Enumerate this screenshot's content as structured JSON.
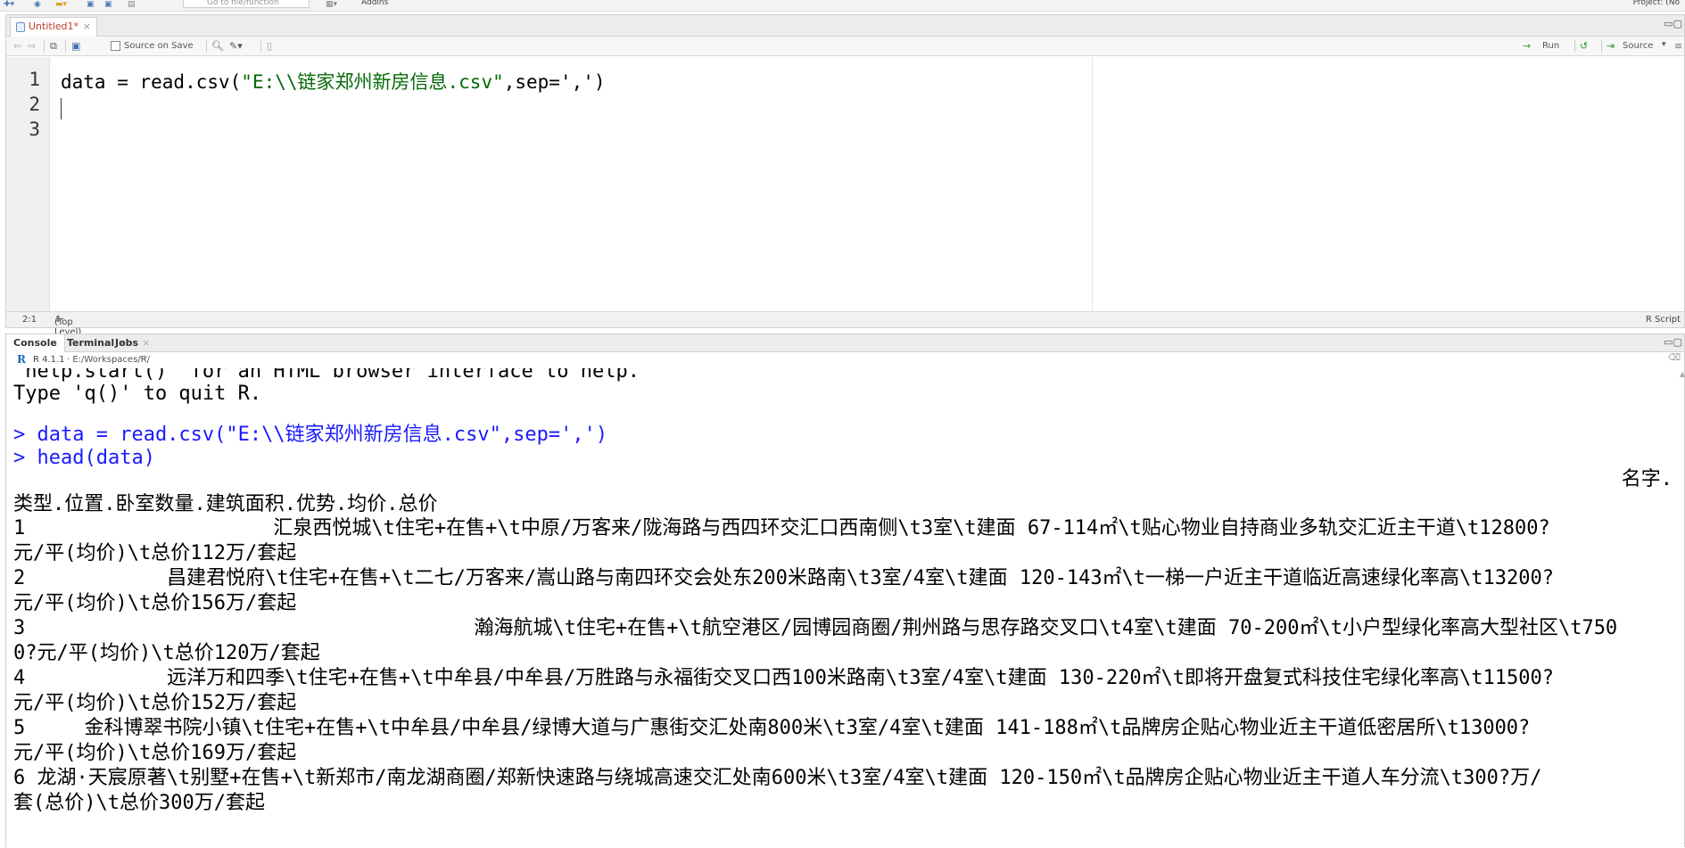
{
  "toolbar": {
    "goto_placeholder": "Go to file/function",
    "addins_label": "Addins",
    "project_label": "Project: (No"
  },
  "editor": {
    "tab_label": "Untitled1*",
    "source_on_save_label": "Source on Save",
    "run_label": "Run",
    "source_label": "Source",
    "line_numbers": [
      "1",
      "2",
      "3"
    ],
    "code_prefix": "data = read.csv(",
    "code_string": "\"E:\\\\链家郑州新房信息.csv\"",
    "code_suffix": ",sep=',')",
    "status_position": "2:1",
    "status_scope": "(Top Level)",
    "status_type": "R Script"
  },
  "console": {
    "tabs": [
      {
        "label": "Console"
      },
      {
        "label": "Terminal"
      },
      {
        "label": "Jobs"
      }
    ],
    "r_version": "R 4.1.1",
    "path": "· E:/Workspaces/R/",
    "lines": [
      "'help.start()' for an HTML browser interface to help.",
      "Type 'q()' to quit R.",
      "",
      "> data = read.csv(\"E:\\\\链家郑州新房信息.csv\",sep=',')",
      "> head(data)",
      "名字.",
      "类型.位置.卧室数量.建筑面积.优势.均价.总价",
      "1                     汇泉西悦城\\t住宅+在售+\\t中原/万客来/陇海路与西四环交汇口西南侧\\t3室\\t建面 67-114㎡\\t贴心物业自持商业多轨交汇近主干道\\t12800?",
      "元/平(均价)\\t总价112万/套起",
      "2            昌建君悦府\\t住宅+在售+\\t二七/万客来/嵩山路与南四环交会处东200米路南\\t3室/4室\\t建面 120-143㎡\\t一梯一户近主干道临近高速绿化率高\\t13200?",
      "元/平(均价)\\t总价156万/套起",
      "3                                      瀚海航城\\t住宅+在售+\\t航空港区/园博园商圈/荆州路与思存路交叉口\\t4室\\t建面 70-200㎡\\t小户型绿化率高大型社区\\t750",
      "0?元/平(均价)\\t总价120万/套起",
      "4            远洋万和四季\\t住宅+在售+\\t中牟县/中牟县/万胜路与永福街交叉口西100米路南\\t3室/4室\\t建面 130-220㎡\\t即将开盘复式科技住宅绿化率高\\t11500?",
      "元/平(均价)\\t总价152万/套起",
      "5     金科博翠书院小镇\\t住宅+在售+\\t中牟县/中牟县/绿博大道与广惠街交汇处南800米\\t3室/4室\\t建面 141-188㎡\\t品牌房企贴心物业近主干道低密居所\\t13000?",
      "元/平(均价)\\t总价169万/套起",
      "6 龙湖·天宸原著\\t别墅+在售+\\t新郑市/南龙湖商圈/郑新快速路与绕城高速交汇处南600米\\t3室/4室\\t建面 120-150㎡\\t品牌房企贴心物业近主干道人车分流\\t300?万/",
      "套(总价)\\t总价300万/套起"
    ]
  }
}
